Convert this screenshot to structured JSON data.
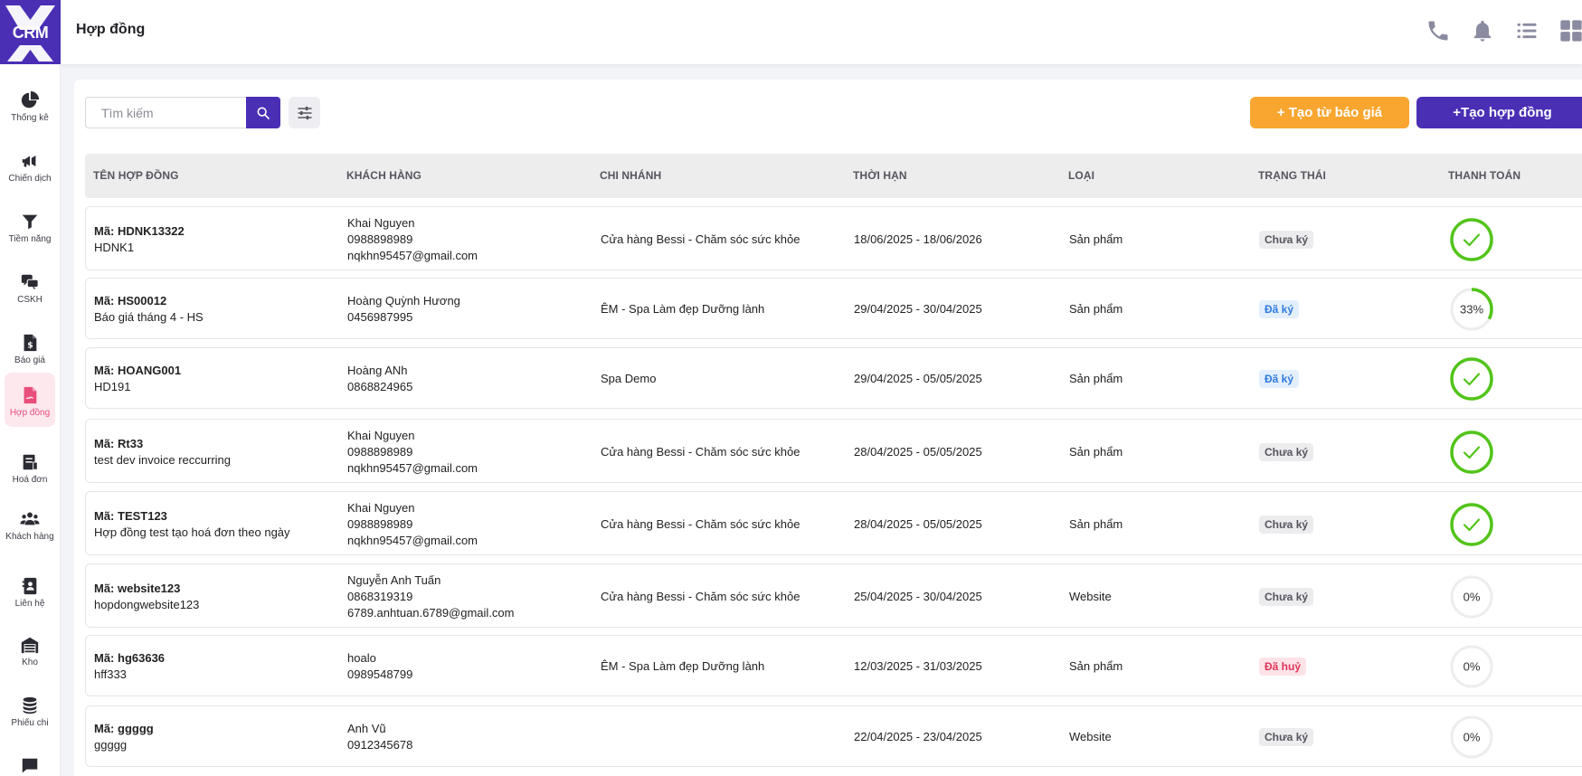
{
  "app": {
    "logo_text": "CRM",
    "page_title": "Hợp đồng"
  },
  "colors": {
    "brand": "#4a2fb5",
    "accent_orange": "#f8a630",
    "active_pink": "#e84f7b",
    "success": "#52c41a"
  },
  "sidebar": {
    "items": [
      {
        "label": "Thống kê",
        "icon": "pie-chart-icon"
      },
      {
        "label": "Chiến dịch",
        "icon": "megaphone-icon"
      },
      {
        "label": "Tiềm năng",
        "icon": "funnel-icon"
      },
      {
        "label": "CSKH",
        "icon": "chat-bubbles-icon"
      },
      {
        "label": "Báo giá",
        "icon": "dollar-document-icon"
      },
      {
        "label": "Hợp đồng",
        "icon": "contract-icon",
        "active": true
      },
      {
        "label": "Hoá đơn",
        "icon": "receipt-icon"
      },
      {
        "label": "Khách hàng",
        "icon": "users-icon"
      },
      {
        "label": "Liên hệ",
        "icon": "address-book-icon"
      },
      {
        "label": "Kho",
        "icon": "warehouse-icon"
      },
      {
        "label": "Phiếu chi",
        "icon": "coins-icon"
      },
      {
        "label": "Trò chuyện",
        "icon": "message-icon"
      }
    ]
  },
  "header_icons": [
    "phone-icon",
    "bell-icon",
    "list-icon",
    "grid-icon"
  ],
  "toolbar": {
    "search_placeholder": "Tìm kiếm",
    "quote_button": "+  Tạo từ báo giá",
    "create_button": "+Tạo hợp đồng"
  },
  "table": {
    "columns": [
      "TÊN HỢP ĐỒNG",
      "KHÁCH HÀNG",
      "CHI NHÁNH",
      "THỜI HẠN",
      "LOẠI",
      "TRẠNG THÁI",
      "THANH TOÁN"
    ],
    "rows": [
      {
        "code": "Mã: HDNK13322",
        "name": "HDNK1",
        "customer": [
          "Khai Nguyen",
          "0988898989",
          "nqkhn95457@gmail.com"
        ],
        "branch": "Cửa hàng Bessi - Chăm sóc sức khỏe",
        "term": "18/06/2025 - 18/06/2026",
        "type": "Sản phẩm",
        "status": "Chưa ký",
        "status_kind": "unsigned",
        "payment": 100,
        "payment_label": ""
      },
      {
        "code": "Mã: HS00012",
        "name": "Báo giá tháng 4 - HS",
        "customer": [
          "Hoàng Quỳnh Hương",
          "0456987995"
        ],
        "branch": "ÊM - Spa Làm đẹp Dưỡng lành",
        "term": "29/04/2025 - 30/04/2025",
        "type": "Sản phẩm",
        "status": "Đã ký",
        "status_kind": "signed",
        "payment": 33,
        "payment_label": "33%"
      },
      {
        "code": "Mã: HOANG001",
        "name": "HD191",
        "customer": [
          "Hoàng ANh",
          "0868824965"
        ],
        "branch": "Spa Demo",
        "term": "29/04/2025 - 05/05/2025",
        "type": "Sản phẩm",
        "status": "Đã ký",
        "status_kind": "signed",
        "payment": 100,
        "payment_label": ""
      },
      {
        "code": "Mã: Rt33",
        "name": "test dev invoice reccurring",
        "customer": [
          "Khai Nguyen",
          "0988898989",
          "nqkhn95457@gmail.com"
        ],
        "branch": "Cửa hàng Bessi - Chăm sóc sức khỏe",
        "term": "28/04/2025 - 05/05/2025",
        "type": "Sản phẩm",
        "status": "Chưa ký",
        "status_kind": "unsigned",
        "payment": 100,
        "payment_label": ""
      },
      {
        "code": "Mã: TEST123",
        "name": "Hợp đồng test tạo hoá đơn theo ngày",
        "customer": [
          "Khai Nguyen",
          "0988898989",
          "nqkhn95457@gmail.com"
        ],
        "branch": "Cửa hàng Bessi - Chăm sóc sức khỏe",
        "term": "28/04/2025 - 05/05/2025",
        "type": "Sản phẩm",
        "status": "Chưa ký",
        "status_kind": "unsigned",
        "payment": 100,
        "payment_label": ""
      },
      {
        "code": "Mã: website123",
        "name": "hopdongwebsite123",
        "customer": [
          "Nguyễn Anh Tuấn",
          "0868319319",
          "6789.anhtuan.6789@gmail.com"
        ],
        "branch": "Cửa hàng Bessi - Chăm sóc sức khỏe",
        "term": "25/04/2025 - 30/04/2025",
        "type": "Website",
        "status": "Chưa ký",
        "status_kind": "unsigned",
        "payment": 0,
        "payment_label": "0%"
      },
      {
        "code": "Mã: hg63636",
        "name": "hff333",
        "customer": [
          "hoalo",
          "0989548799"
        ],
        "branch": "ÊM - Spa Làm đẹp Dưỡng lành",
        "term": "12/03/2025 - 31/03/2025",
        "type": "Sản phẩm",
        "status": "Đã huỷ",
        "status_kind": "cancel",
        "payment": 0,
        "payment_label": "0%"
      },
      {
        "code": "Mã: ggggg",
        "name": "ggggg",
        "customer": [
          "Anh  Vũ",
          "0912345678"
        ],
        "branch": "",
        "term": "22/04/2025 - 23/04/2025",
        "type": "Website",
        "status": "Chưa ký",
        "status_kind": "unsigned",
        "payment": 0,
        "payment_label": "0%"
      }
    ]
  }
}
